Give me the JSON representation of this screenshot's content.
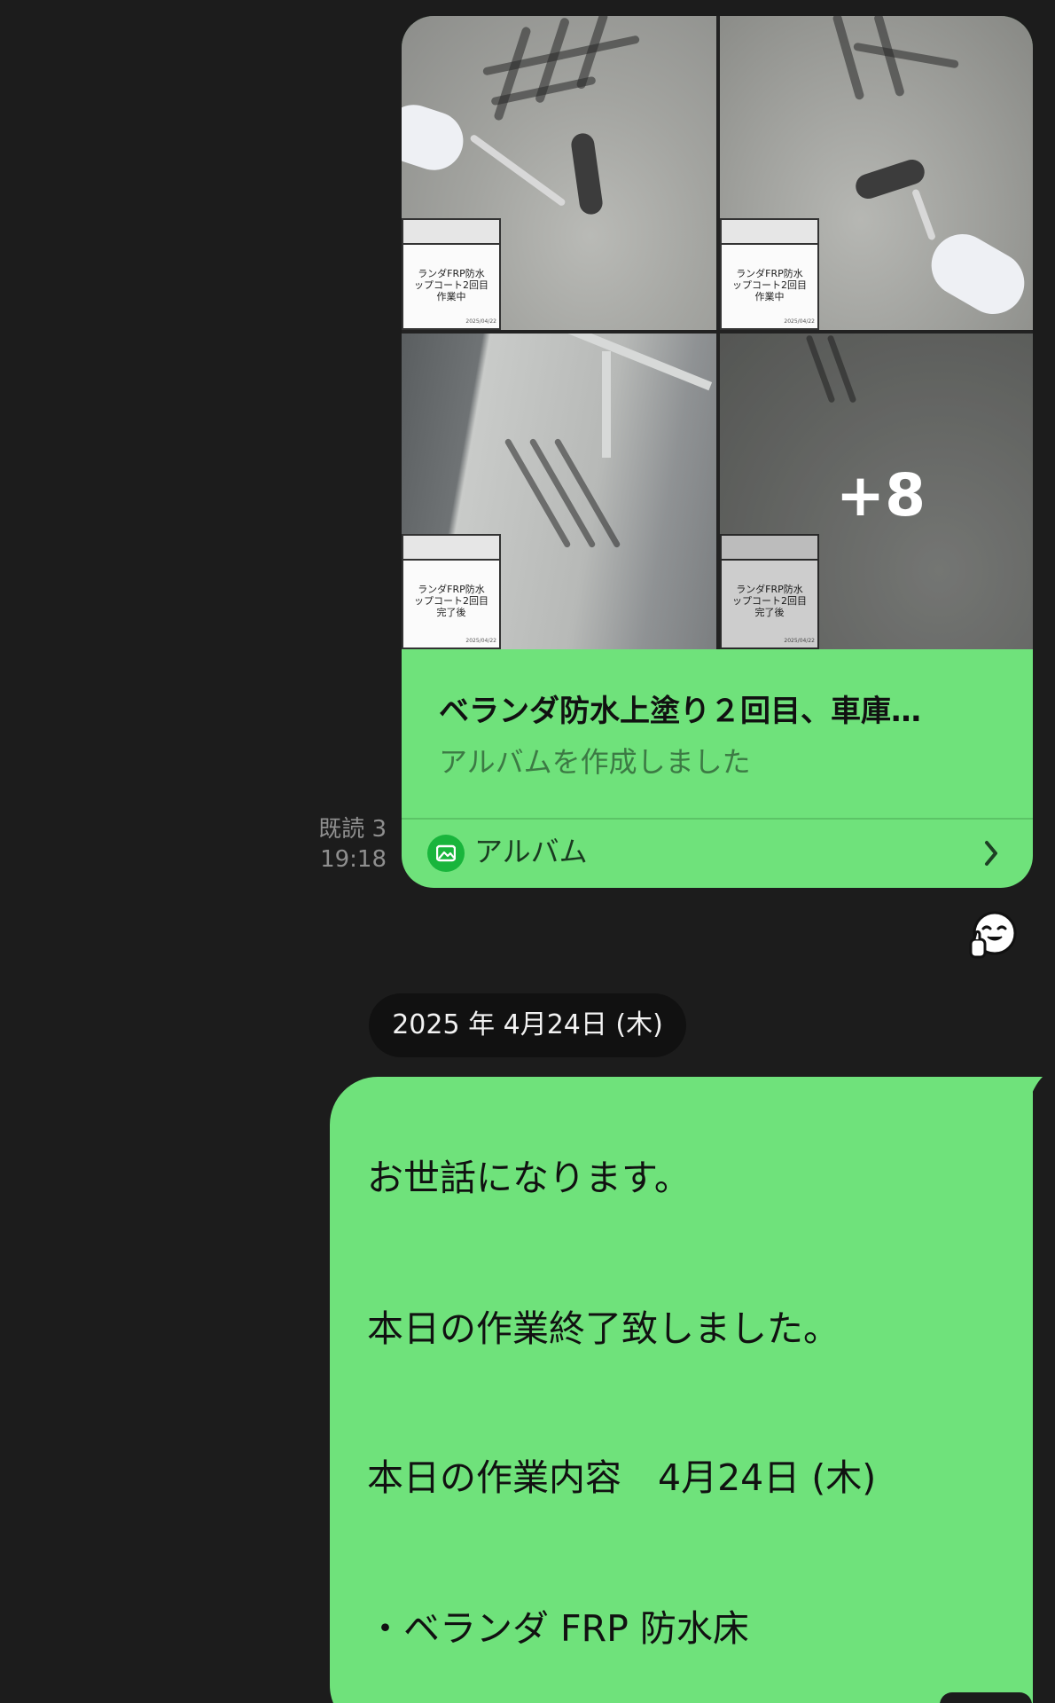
{
  "album": {
    "more_count": "+8",
    "title": "ベランダ防水上塗り２回目、車庫…",
    "subtitle": "アルバムを作成しました",
    "footer_label": "アルバム",
    "footer_icon": "album-icon",
    "chevron_icon": "chevron-right-icon",
    "accent_color": "#6fe27b",
    "photos": [
      {
        "sign_lines": [
          "ランダFRP防水",
          "ップコート2回目",
          "作業中"
        ],
        "sign_date": "2025/04/22"
      },
      {
        "sign_lines": [
          "ランダFRP防水",
          "ップコート2回目",
          "作業中"
        ],
        "sign_date": "2025/04/22"
      },
      {
        "sign_lines": [
          "ランダFRP防水",
          "ップコート2回目",
          "完了後"
        ],
        "sign_date": "2025/04/22"
      },
      {
        "sign_lines": [
          "ランダFRP防水",
          "ップコート2回目",
          "完了後"
        ],
        "sign_date": "2025/04/22"
      }
    ]
  },
  "read_status": {
    "read_label": "既読 3",
    "time": "19:18"
  },
  "reaction": {
    "icon": "thumbs-up-sticker-icon"
  },
  "date_separator": "2025 年 4月24日 (木)",
  "message": {
    "lines": [
      "お世話になります。",
      "本日の作業終了致しました。",
      "本日の作業内容　4月24日 (木)",
      "・ベランダ FRP 防水床"
    ]
  }
}
